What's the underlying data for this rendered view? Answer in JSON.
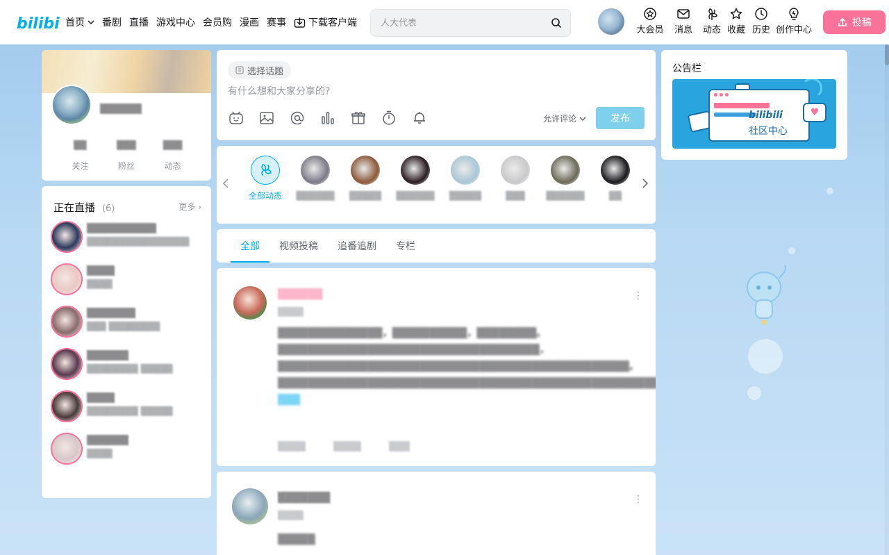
{
  "header": {
    "logo_text": "bilibili",
    "nav": [
      {
        "id": "home",
        "label": "首页",
        "has_dropdown": true
      },
      {
        "id": "anime",
        "label": "番剧"
      },
      {
        "id": "live",
        "label": "直播"
      },
      {
        "id": "game",
        "label": "游戏中心"
      },
      {
        "id": "mall",
        "label": "会员购"
      },
      {
        "id": "manga",
        "label": "漫画"
      },
      {
        "id": "esports",
        "label": "赛事"
      },
      {
        "id": "download",
        "label": "下载客户端",
        "icon": "download-icon"
      }
    ],
    "search_placeholder": "人大代表",
    "tools": [
      {
        "id": "vip",
        "label": "大会员",
        "icon": "vip-icon"
      },
      {
        "id": "message",
        "label": "消息",
        "icon": "mail-icon"
      },
      {
        "id": "dynamic",
        "label": "动态",
        "icon": "windmill-icon"
      },
      {
        "id": "favorite",
        "label": "收藏",
        "icon": "star-icon"
      },
      {
        "id": "history",
        "label": "历史",
        "icon": "clock-icon"
      },
      {
        "id": "creator",
        "label": "创作中心",
        "icon": "bulb-icon"
      }
    ],
    "upload_label": "投稿"
  },
  "profile": {
    "name": "▒▒▒▒▒▒",
    "stats": [
      {
        "label": "关注",
        "value": "▒▒"
      },
      {
        "label": "粉丝",
        "value": "▒▒▒"
      },
      {
        "label": "动态",
        "value": "▒▒▒"
      }
    ]
  },
  "live": {
    "title": "正在直播",
    "count": "(6)",
    "more": "更多",
    "items": [
      {
        "name": "▒▒▒▒▒▒▒▒▒▒",
        "desc": "▒▒▒▒▒▒▒▒▒▒▒▒▒▒▒▒",
        "color": "#2d3b5c"
      },
      {
        "name": "▒▒▒▒",
        "desc": "▒▒▒▒",
        "color": "#e9c9c4"
      },
      {
        "name": "▒▒▒▒▒▒▒",
        "desc": "▒▒▒ ▒▒▒▒▒▒▒▒",
        "color": "#8a6c6a"
      },
      {
        "name": "▒▒▒▒▒▒",
        "desc": "▒▒▒▒▒▒▒▒ ▒▒▒▒▒",
        "color": "#5a3b4e"
      },
      {
        "name": "▒▒▒▒",
        "desc": "▒▒▒▒▒▒▒▒ ▒▒▒▒▒",
        "color": "#4a3b3a"
      },
      {
        "name": "▒▒▒▒▒▒",
        "desc": "▒▒▒▒",
        "color": "#d8c7c9"
      }
    ]
  },
  "compose": {
    "topic_label": "选择话题",
    "placeholder": "有什么想和大家分享的?",
    "tools": [
      "emoji-icon",
      "image-icon",
      "at-icon",
      "vote-icon",
      "gift-icon",
      "timer-icon",
      "reserve-icon"
    ],
    "comment_option": "允许评论",
    "publish_label": "发布"
  },
  "ups": {
    "all_label": "全部动态",
    "items": [
      {
        "name": "▒▒▒▒▒▒",
        "color": "#7d7a87"
      },
      {
        "name": "▒▒▒▒▒",
        "color": "#8b5a3a"
      },
      {
        "name": "▒▒▒▒▒▒",
        "color": "#2b1e22"
      },
      {
        "name": "▒▒▒▒▒",
        "color": "#a9c6d6"
      },
      {
        "name": "▒▒▒",
        "color": "#c9c9cb"
      },
      {
        "name": "▒▒▒▒▒▒",
        "color": "#6e6a58"
      },
      {
        "name": "▒▒",
        "color": "#1a1a1e"
      }
    ]
  },
  "tabs": [
    {
      "id": "all",
      "label": "全部",
      "active": true
    },
    {
      "id": "video",
      "label": "视频投稿"
    },
    {
      "id": "bangumi",
      "label": "追番追剧"
    },
    {
      "id": "article",
      "label": "专栏"
    }
  ],
  "feed": [
    {
      "author": "▒▒▒▒▒▒",
      "time": "▒▒▒▒",
      "body": "▒▒▒▒▒▒▒▒▒▒▒▒▒▒，▒▒▒▒▒▒▒▒▒▒，▒▒▒▒▒▒▒▒。▒▒▒▒▒▒▒▒▒▒▒▒▒▒▒▒▒▒▒▒▒▒▒▒▒▒▒▒▒▒▒▒▒▒▒，▒▒▒▒▒▒▒▒▒▒▒▒▒▒▒▒▒▒▒▒▒▒▒▒▒▒▒▒▒▒▒▒▒▒▒▒▒▒▒▒▒▒▒▒▒▒▒。▒▒▒▒▒▒▒▒▒▒▒▒▒▒▒▒▒▒▒▒▒▒▒▒▒▒▒▒▒▒▒▒▒▒▒▒▒▒▒▒▒▒▒▒▒▒▒▒▒▒▒▒▒▒▒▒▒▒▒▒▒▒。",
      "tag": "▒▒▒",
      "actions": [
        "▒▒▒▒",
        "▒▒▒▒",
        "▒▒▒"
      ],
      "color": "#c96a5a"
    },
    {
      "author": "▒▒▒▒▒▒▒",
      "time": "▒▒▒▒",
      "body": "▒▒▒▒▒",
      "color": "#8aa6b8"
    }
  ],
  "notice": {
    "title": "公告栏",
    "banner_logo": "bilibili",
    "banner_text": "社区中心"
  }
}
